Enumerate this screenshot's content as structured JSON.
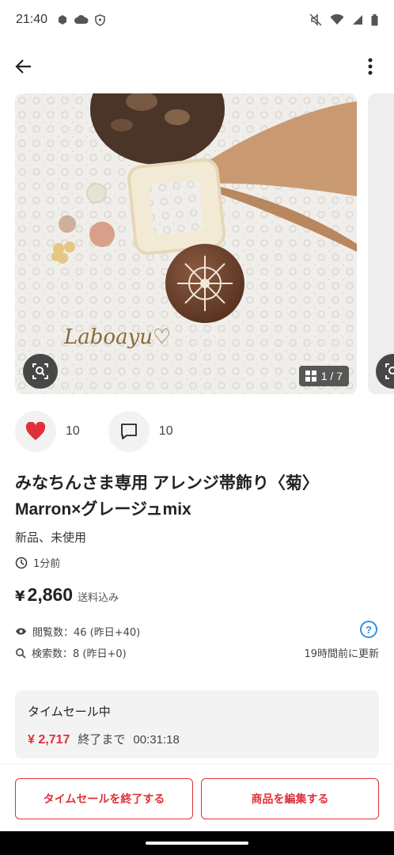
{
  "status_bar": {
    "time": "21:40"
  },
  "photo": {
    "signature": "Laboayu♡",
    "counter": "1 / 7"
  },
  "actions": {
    "like_count": "10",
    "comment_count": "10",
    "like_color": "#e0303a"
  },
  "item": {
    "title": "みなちんさま専用 アレンジ帯飾り〈菊〉Marron×グレージュmix",
    "condition": "新品、未使用",
    "posted": "1分前",
    "currency": "¥",
    "price": "2,860",
    "shipping": "送料込み"
  },
  "stats": {
    "views": "閲覧数：46 (昨日+40)",
    "searches": "検索数：8 (昨日+0)",
    "updated": "19時間前に更新",
    "help": "?"
  },
  "sale": {
    "label": "タイムセール中",
    "price": "¥ 2,717",
    "until": "終了まで",
    "timer": "00:31:18"
  },
  "buttons": {
    "end_sale": "タイムセールを終了する",
    "edit_item": "商品を編集する"
  },
  "colors": {
    "accent": "#e0303a",
    "info": "#2f8fe6"
  }
}
